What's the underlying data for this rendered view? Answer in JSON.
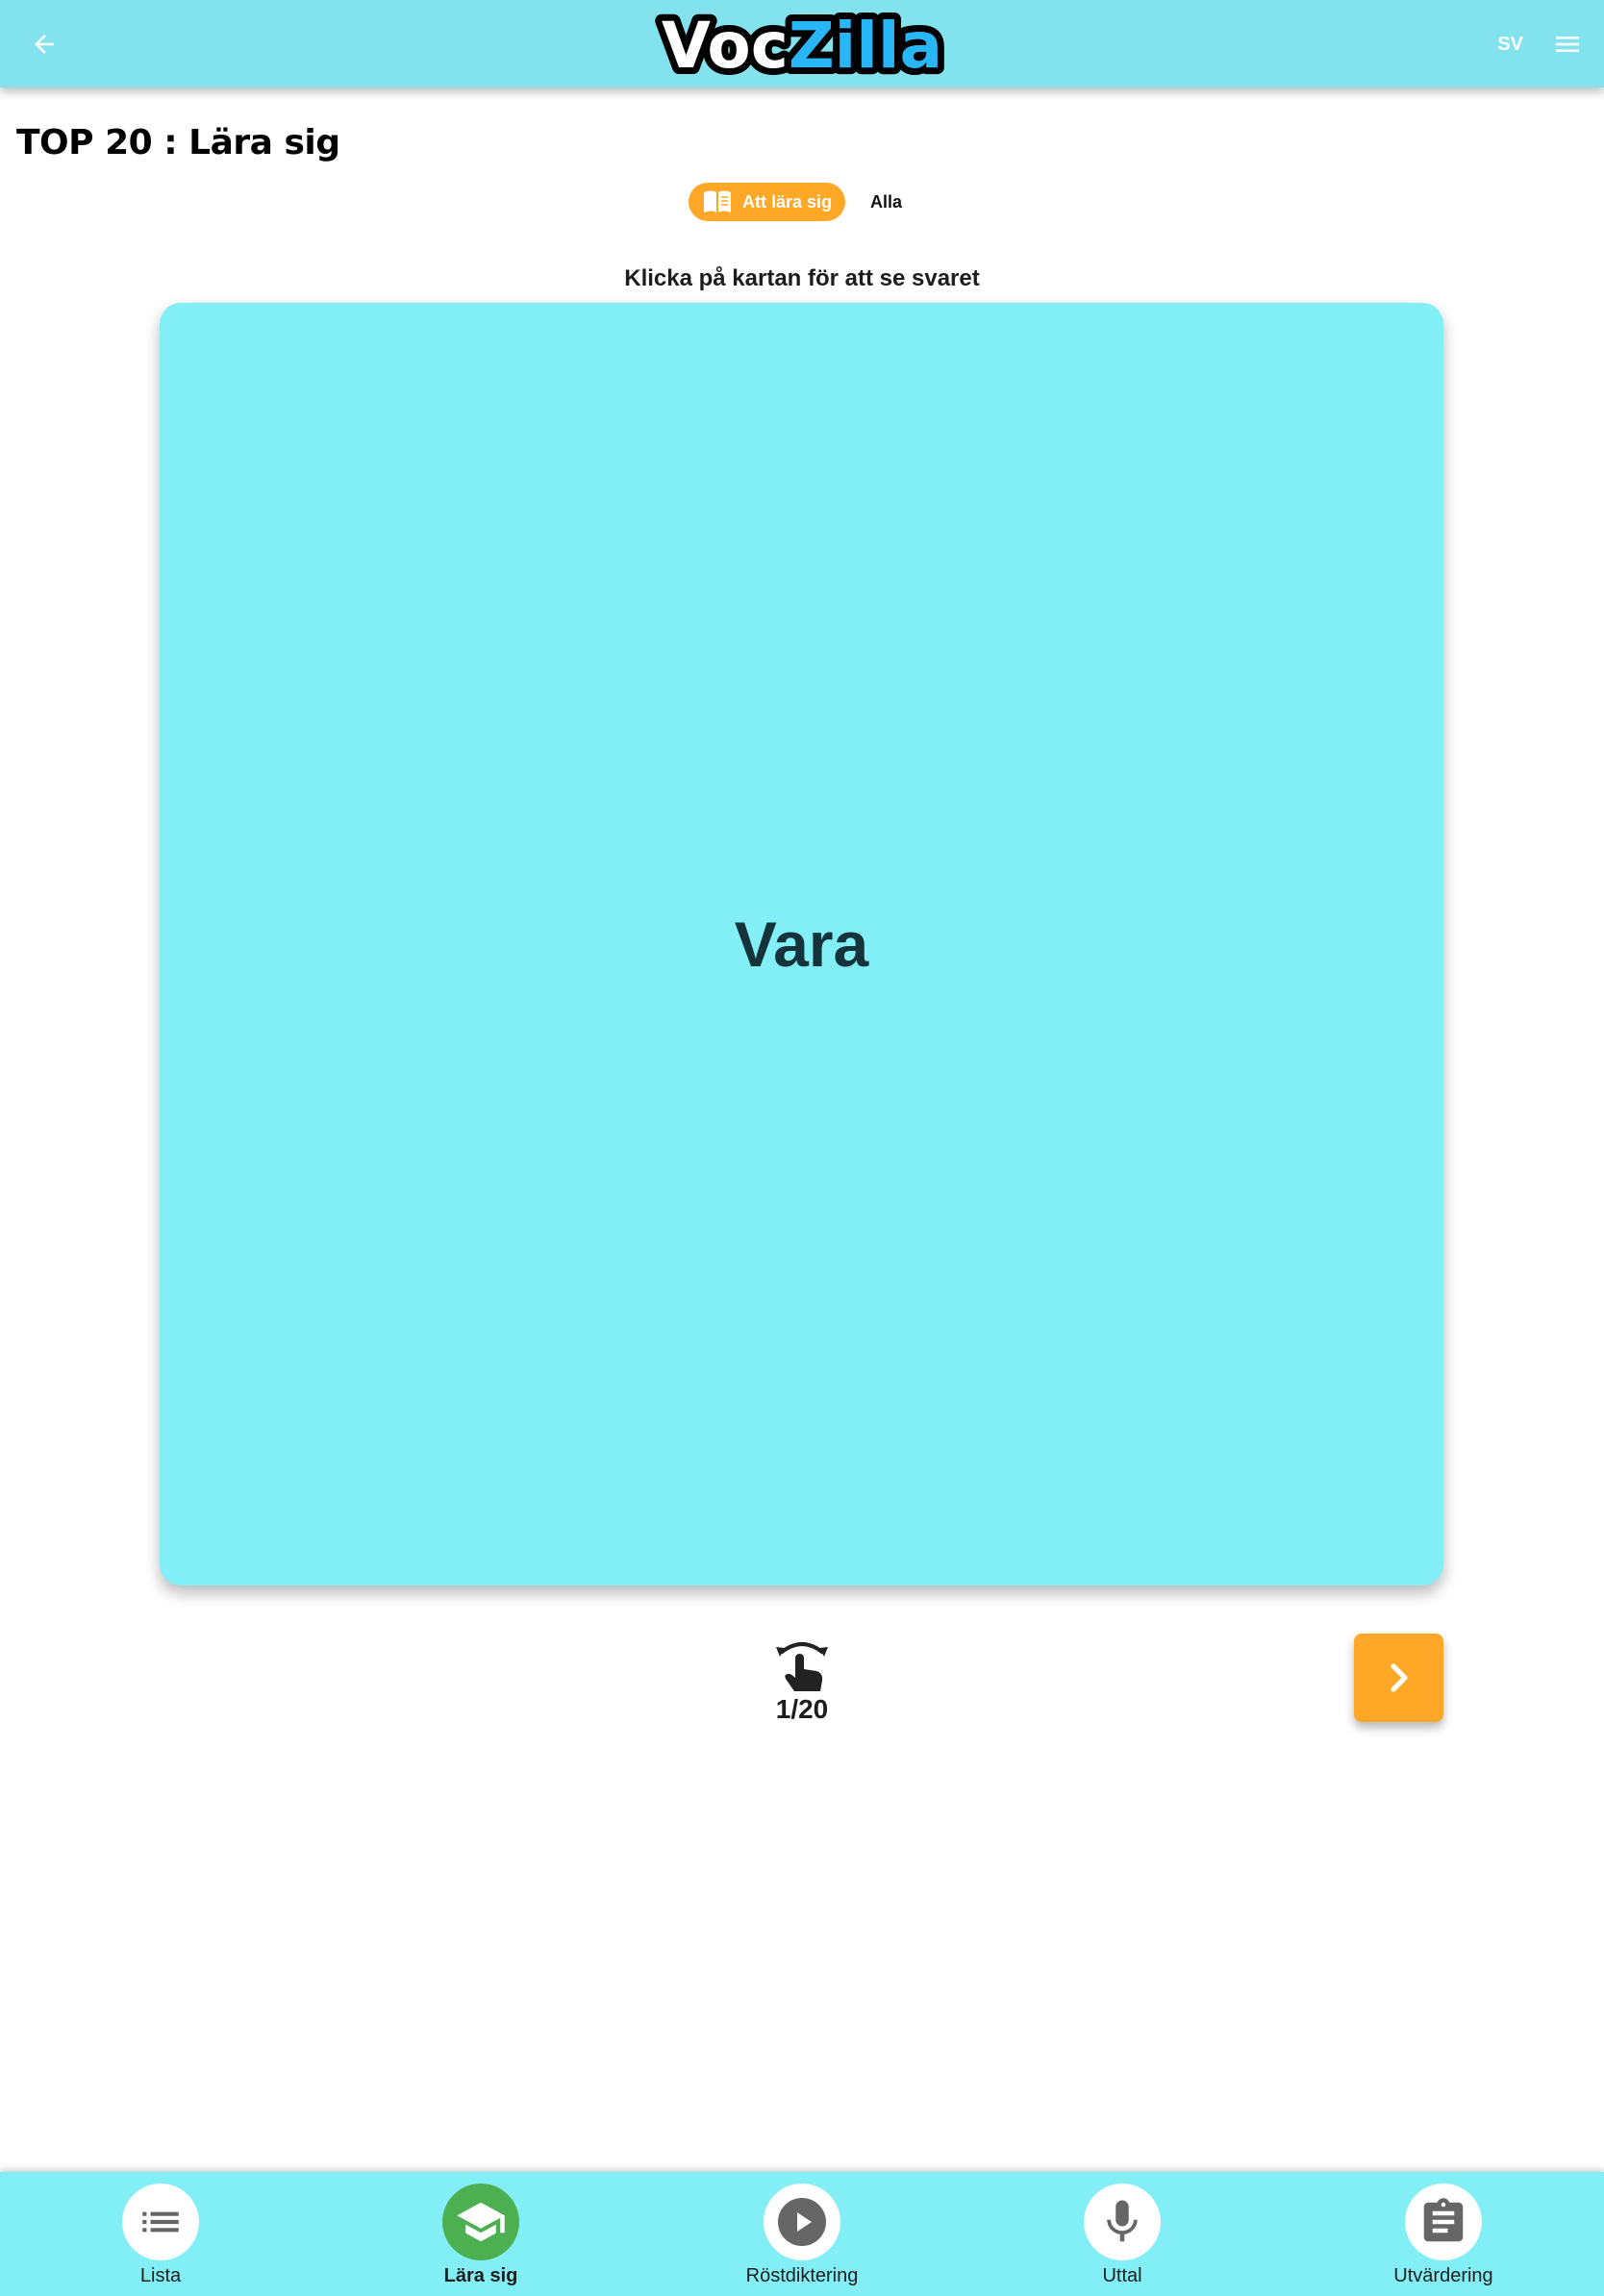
{
  "header": {
    "logo_text": "VocZilla",
    "language": "SV",
    "colors": {
      "bar": "#82e3ef",
      "logo_blue": "#29b6f6"
    }
  },
  "page": {
    "title": "TOP 20 : Lära sig"
  },
  "filters": {
    "active_label": "Att lära sig",
    "other_label": "Alla",
    "active_color": "#ffa726"
  },
  "card": {
    "instruction": "Klicka på kartan för att se svaret",
    "word": "Vara",
    "color": "#82eff6"
  },
  "progress": {
    "counter": "1/20",
    "current": 1,
    "total": 20
  },
  "bottom_nav": {
    "items": [
      {
        "label": "Lista",
        "icon": "list-icon"
      },
      {
        "label": "Lära sig",
        "icon": "graduation-cap-icon",
        "active": true
      },
      {
        "label": "Röstdiktering",
        "icon": "play-icon"
      },
      {
        "label": "Uttal",
        "icon": "microphone-icon"
      },
      {
        "label": "Utvärdering",
        "icon": "clipboard-icon"
      }
    ]
  }
}
